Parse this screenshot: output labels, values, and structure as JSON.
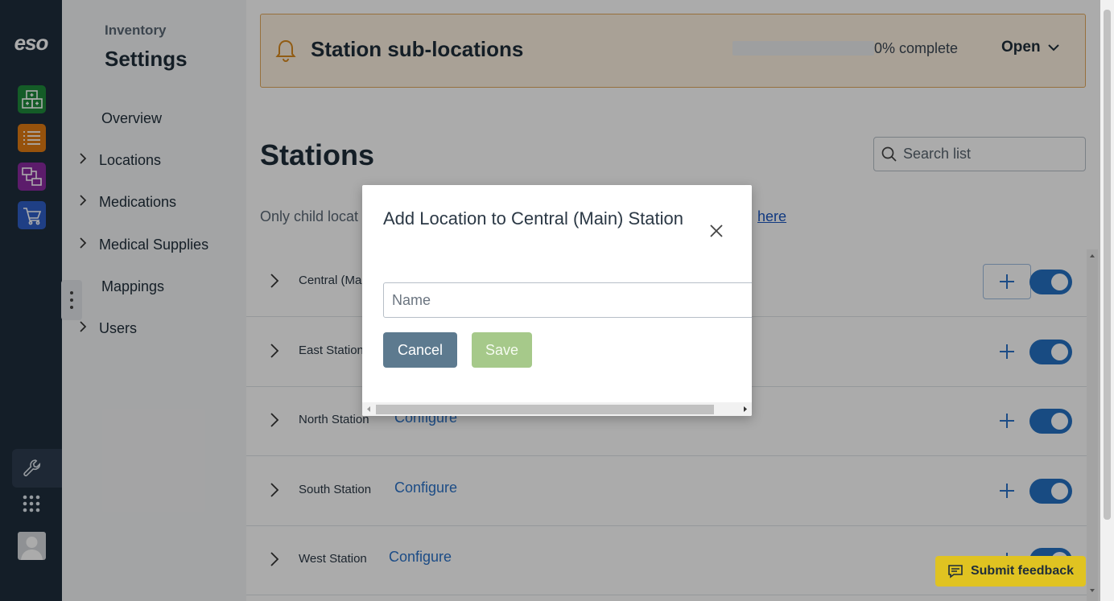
{
  "rail": {
    "logo": "eso",
    "apps": [
      {
        "icon": "inventory-boxes-icon",
        "color": "#1e8a3b"
      },
      {
        "icon": "list-icon",
        "color": "#e07b13"
      },
      {
        "icon": "workflow-icon",
        "color": "#8a2aa0"
      },
      {
        "icon": "cart-icon",
        "color": "#2f5fc7"
      }
    ]
  },
  "nav": {
    "eyebrow": "Inventory",
    "title": "Settings",
    "items": [
      {
        "label": "Overview",
        "expandable": false
      },
      {
        "label": "Locations",
        "expandable": true
      },
      {
        "label": "Medications",
        "expandable": true
      },
      {
        "label": "Medical Supplies",
        "expandable": true
      },
      {
        "label": "Mappings",
        "expandable": false
      },
      {
        "label": "Users",
        "expandable": true
      }
    ]
  },
  "banner": {
    "title": "Station sub-locations",
    "progress": 0,
    "progress_label": "0% complete",
    "open_label": "Open"
  },
  "main": {
    "heading": "Stations",
    "search_placeholder": "Search list",
    "info_text": "Only child locat",
    "info_link": "here"
  },
  "stations": [
    {
      "name": "Central (Ma",
      "configure": ""
    },
    {
      "name": "East Station",
      "configure": ""
    },
    {
      "name": "North Station",
      "configure": "Configure"
    },
    {
      "name": "South Station",
      "configure": "Configure"
    },
    {
      "name": "West Station",
      "configure": "Configure"
    }
  ],
  "modal": {
    "title": "Add Location to Central (Main) Station",
    "name_placeholder": "Name",
    "name_value": "",
    "cancel_label": "Cancel",
    "save_label": "Save"
  },
  "feedback": {
    "label": "Submit feedback"
  }
}
